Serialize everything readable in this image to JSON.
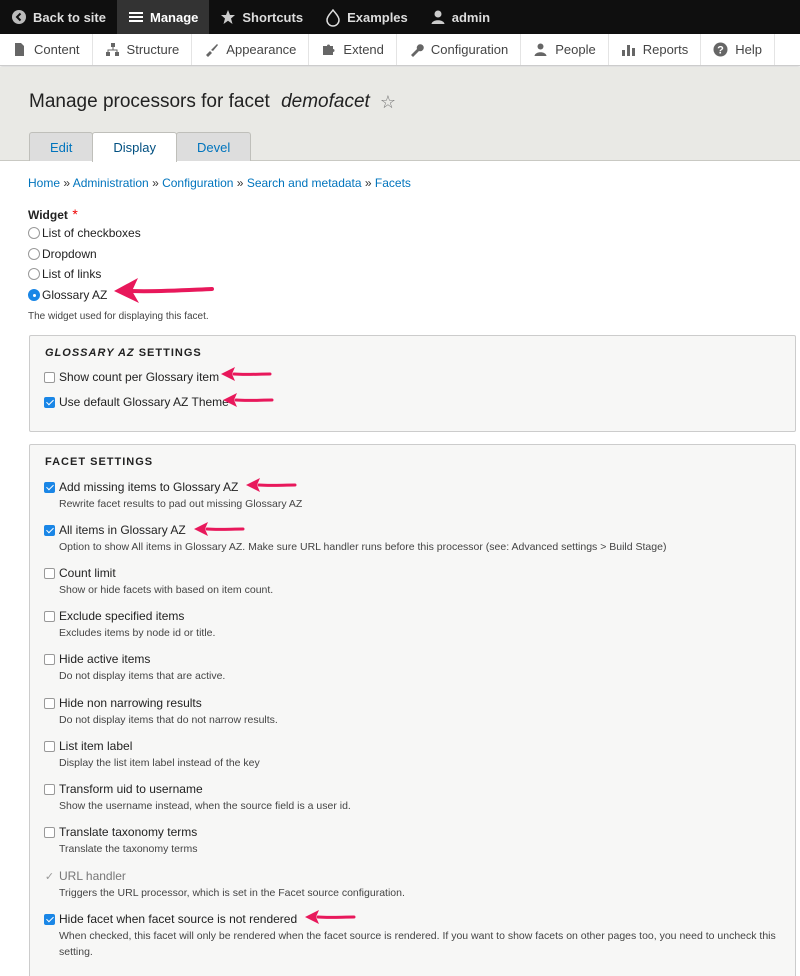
{
  "toolbar": {
    "back": "Back to site",
    "manage": "Manage",
    "shortcuts": "Shortcuts",
    "examples": "Examples",
    "user": "admin"
  },
  "tray": [
    {
      "label": "Content",
      "icon": "document-icon"
    },
    {
      "label": "Structure",
      "icon": "structure-icon"
    },
    {
      "label": "Appearance",
      "icon": "brush-icon"
    },
    {
      "label": "Extend",
      "icon": "puzzle-icon"
    },
    {
      "label": "Configuration",
      "icon": "wrench-icon"
    },
    {
      "label": "People",
      "icon": "people-icon"
    },
    {
      "label": "Reports",
      "icon": "bar-chart-icon"
    },
    {
      "label": "Help",
      "icon": "help-icon"
    }
  ],
  "page": {
    "title_prefix": "Manage processors for facet ",
    "title_facet": "demofacet",
    "tabs": [
      "Edit",
      "Display",
      "Devel"
    ],
    "active_tab": "Display"
  },
  "breadcrumb": [
    "Home",
    "Administration",
    "Configuration",
    "Search and metadata",
    "Facets"
  ],
  "widget": {
    "label": "Widget",
    "required_mark": "*",
    "options": [
      "List of checkboxes",
      "Dropdown",
      "List of links",
      "Glossary AZ"
    ],
    "selected": "Glossary AZ",
    "description": "The widget used for displaying this facet."
  },
  "glossary_settings": {
    "legend_italic": "GLOSSARY AZ",
    "legend_rest": " SETTINGS",
    "items": [
      {
        "label": "Show count per Glossary item",
        "checked": false
      },
      {
        "label": "Use default Glossary AZ Theme",
        "checked": true
      }
    ]
  },
  "facet_settings": {
    "legend": "FACET SETTINGS",
    "items": [
      {
        "label": "Add missing items to Glossary AZ",
        "desc": "Rewrite facet results to pad out missing Glossary AZ",
        "checked": true
      },
      {
        "label": "All items in Glossary AZ",
        "desc": "Option to show All items in Glossary AZ. Make sure URL handler runs before this processor (see: Advanced settings > Build Stage)",
        "checked": true
      },
      {
        "label": "Count limit",
        "desc": "Show or hide facets with based on item count.",
        "checked": false
      },
      {
        "label": "Exclude specified items",
        "desc": "Excludes items by node id or title.",
        "checked": false
      },
      {
        "label": "Hide active items",
        "desc": "Do not display items that are active.",
        "checked": false
      },
      {
        "label": "Hide non narrowing results",
        "desc": "Do not display items that do not narrow results.",
        "checked": false
      },
      {
        "label": "List item label",
        "desc": "Display the list item label instead of the key",
        "checked": false
      },
      {
        "label": "Transform uid to username",
        "desc": "Show the username instead, when the source field is a user id.",
        "checked": false
      },
      {
        "label": "Translate taxonomy terms",
        "desc": "Translate the taxonomy terms",
        "checked": false
      },
      {
        "label": "URL handler",
        "desc": "Triggers the URL processor, which is set in the Facet source configuration.",
        "checked": true,
        "disabled": true
      },
      {
        "label": "Hide facet when facet source is not rendered",
        "desc": "When checked, this facet will only be rendered when the facet source is rendered. If you want to show facets on other pages too, you need to uncheck this setting.",
        "checked": true
      }
    ]
  },
  "colors": {
    "accent": "#1a86e6",
    "link": "#0074bd",
    "arrow": "#e8185b"
  }
}
